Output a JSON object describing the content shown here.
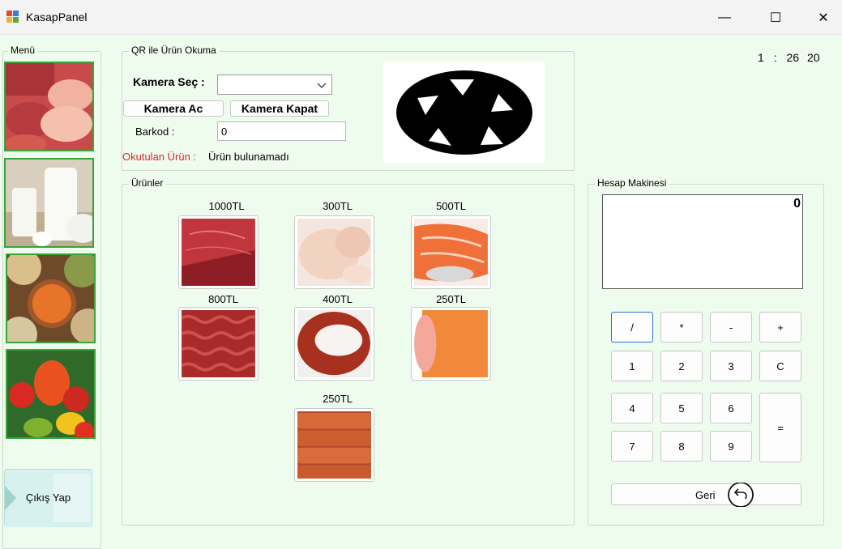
{
  "window": {
    "title": "KasapPanel",
    "controls": {
      "minimize": "—",
      "maximize": "☐",
      "close": "✕"
    }
  },
  "clock": {
    "hour": "1",
    "sep": ":",
    "minute": "26",
    "second": "20"
  },
  "menu": {
    "label": "Menü",
    "items": [
      {
        "icon": "meat-icon"
      },
      {
        "icon": "dairy-icon"
      },
      {
        "icon": "legumes-icon"
      },
      {
        "icon": "vegetables-icon"
      }
    ],
    "logout": "Çıkış Yap"
  },
  "qr": {
    "label": "QR ile Ürün Okuma",
    "camera_select_label": "Kamera Seç :",
    "camera_select_value": "",
    "camera_open": "Kamera Ac",
    "camera_close": "Kamera Kapat",
    "barcode_label": "Barkod :",
    "barcode_value": "0",
    "scanned_label": "Okutulan Ürün :",
    "scanned_value": "Ürün bulunamadı",
    "camera_icon": "camera-shutter-icon"
  },
  "products": {
    "label": "Ürünler",
    "items": [
      {
        "price": "1000TL",
        "image": "beef-steak"
      },
      {
        "price": "300TL",
        "image": "raw-chicken"
      },
      {
        "price": "500TL",
        "image": "salmon-fillet"
      },
      {
        "price": "800TL",
        "image": "ground-meat"
      },
      {
        "price": "400TL",
        "image": "ring-sausage"
      },
      {
        "price": "250TL",
        "image": "salami"
      },
      {
        "price": "250TL",
        "image": "sausages"
      }
    ]
  },
  "calculator": {
    "label": "Hesap Makinesi",
    "display": "0",
    "keys": [
      "/",
      "*",
      "-",
      "+",
      "1",
      "2",
      "3",
      "C",
      "4",
      "5",
      "6",
      "=",
      "7",
      "8",
      "9"
    ],
    "back": "Geri"
  },
  "colors": {
    "background": "#eefcee",
    "menu_border": "#3aa33a",
    "scanned_label": "#e8202a"
  }
}
